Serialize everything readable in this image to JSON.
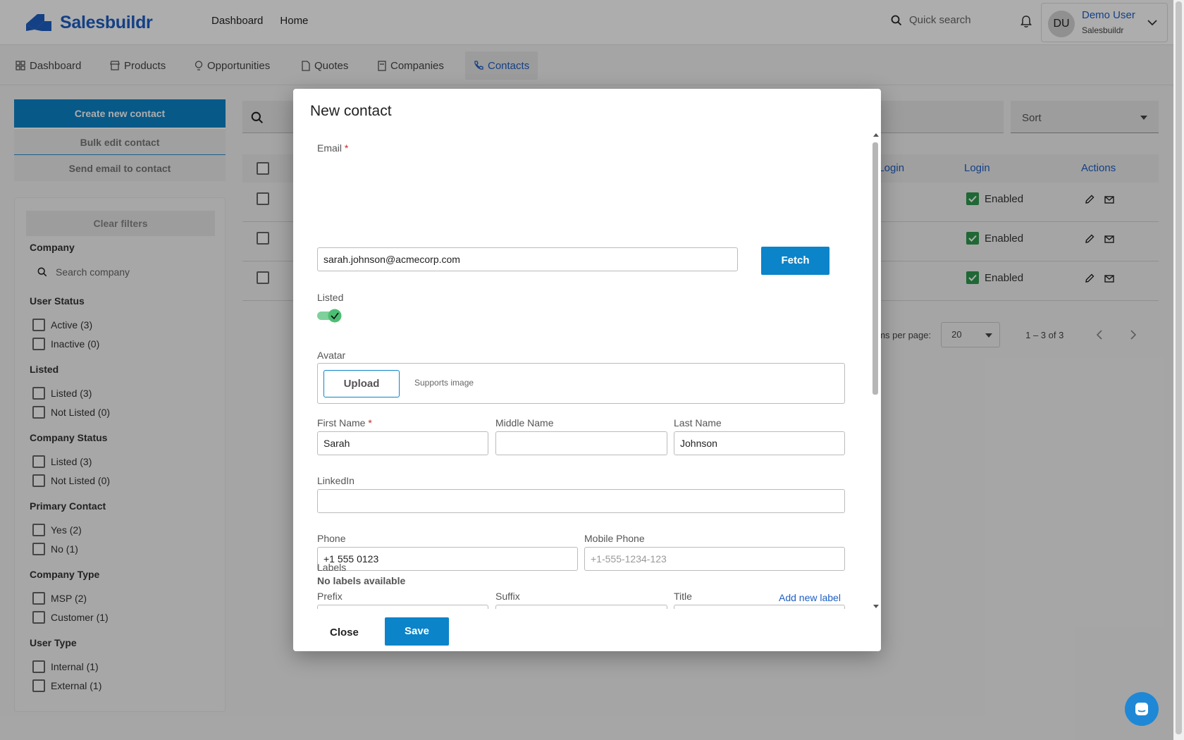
{
  "header": {
    "brand": "Salesbuildr",
    "nav": [
      "Dashboard",
      "Home"
    ],
    "search_placeholder": "Quick search",
    "user": {
      "initials": "DU",
      "name": "Demo User",
      "org": "Salesbuildr"
    }
  },
  "tabs": [
    {
      "label": "Dashboard",
      "icon": "grid-icon"
    },
    {
      "label": "Products",
      "icon": "store-icon"
    },
    {
      "label": "Opportunities",
      "icon": "lightbulb-icon"
    },
    {
      "label": "Quotes",
      "icon": "document-icon"
    },
    {
      "label": "Companies",
      "icon": "building-icon"
    },
    {
      "label": "Contacts",
      "icon": "phone-icon",
      "active": true
    }
  ],
  "actions": {
    "create": "Create new contact",
    "bulk_edit": "Bulk edit contact",
    "send_email": "Send email to contact"
  },
  "filters": {
    "clear": "Clear filters",
    "company_heading": "Company",
    "company_search_placeholder": "Search company",
    "groups": [
      {
        "heading": "User Status",
        "options": [
          "Active (3)",
          "Inactive (0)"
        ]
      },
      {
        "heading": "Listed",
        "options": [
          "Listed (3)",
          "Not Listed (0)"
        ]
      },
      {
        "heading": "Company Status",
        "options": [
          "Listed (3)",
          "Not Listed (0)"
        ]
      },
      {
        "heading": "Primary Contact",
        "options": [
          "Yes (2)",
          "No (1)"
        ]
      },
      {
        "heading": "Company Type",
        "options": [
          "MSP (2)",
          "Customer (1)"
        ]
      },
      {
        "heading": "User Type",
        "options": [
          "Internal (1)",
          "External (1)"
        ]
      }
    ]
  },
  "table": {
    "sort_placeholder": "Sort",
    "columns": {
      "last_login": "t Login",
      "login": "Login",
      "actions": "Actions"
    },
    "rows": [
      {
        "login": "Enabled"
      },
      {
        "login": "Enabled"
      },
      {
        "login": "Enabled"
      }
    ],
    "pager": {
      "label": "ems per page:",
      "per_page": "20",
      "range": "1 – 3 of 3"
    }
  },
  "modal": {
    "title": "New contact",
    "email_label": "Email",
    "email_value": "sarah.johnson@acmecorp.com",
    "fetch": "Fetch",
    "listed_label": "Listed",
    "listed_on": true,
    "avatar_label": "Avatar",
    "upload": "Upload",
    "supports": "Supports image",
    "first_name_label": "First Name",
    "first_name_value": "Sarah",
    "middle_name_label": "Middle Name",
    "middle_name_value": "",
    "last_name_label": "Last Name",
    "last_name_value": "Johnson",
    "linkedin_label": "LinkedIn",
    "linkedin_value": "",
    "phone_label": "Phone",
    "phone_value": "+1 555 0123",
    "mobile_label": "Mobile Phone",
    "mobile_placeholder": "+1-555-1234-123",
    "prefix_label": "Prefix",
    "suffix_label": "Suffix",
    "title_label": "Title",
    "labels_label": "Labels",
    "no_labels": "No labels available",
    "add_label": "Add new label",
    "close": "Close",
    "save": "Save"
  },
  "colors": {
    "primary": "#0b84c9",
    "link": "#1e5fc4",
    "success": "#2e9a4e"
  }
}
